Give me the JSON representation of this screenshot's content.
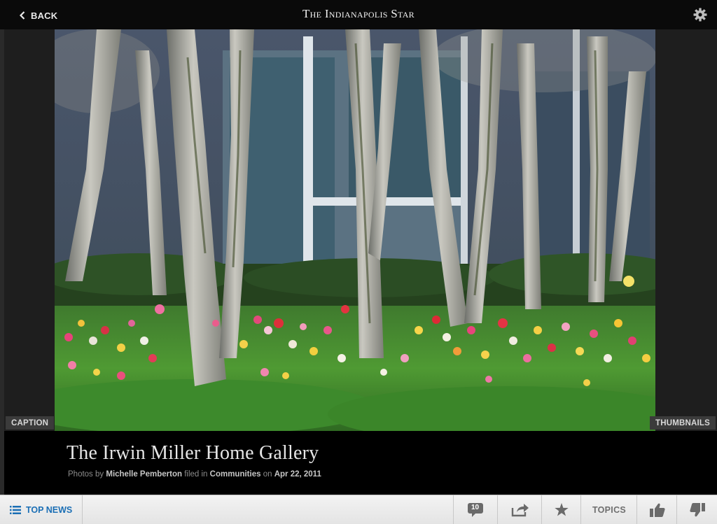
{
  "header": {
    "back_label": "BACK",
    "brand": "The Indianapolis Star"
  },
  "photo": {
    "caption_tab": "CAPTION",
    "thumbnails_tab": "THUMBNAILS"
  },
  "gallery": {
    "title": "The Irwin Miller Home Gallery",
    "photos_by_prefix": "Photos by",
    "photographer": "Michelle Pemberton",
    "filed_in_prefix": "filed in",
    "section": "Communities",
    "on_prefix": "on",
    "date": "Apr 22, 2011"
  },
  "toolbar": {
    "top_news_label": "TOP NEWS",
    "comments_count": "10",
    "topics_label": "TOPICS"
  },
  "colors": {
    "accent_blue": "#1b6fb5",
    "toolbar_icon": "#6a6a6a"
  },
  "icons": [
    "chevron-left-icon",
    "gear-icon",
    "list-icon",
    "comment-bubble-icon",
    "share-icon",
    "star-icon",
    "thumbs-up-icon",
    "thumbs-down-icon"
  ]
}
